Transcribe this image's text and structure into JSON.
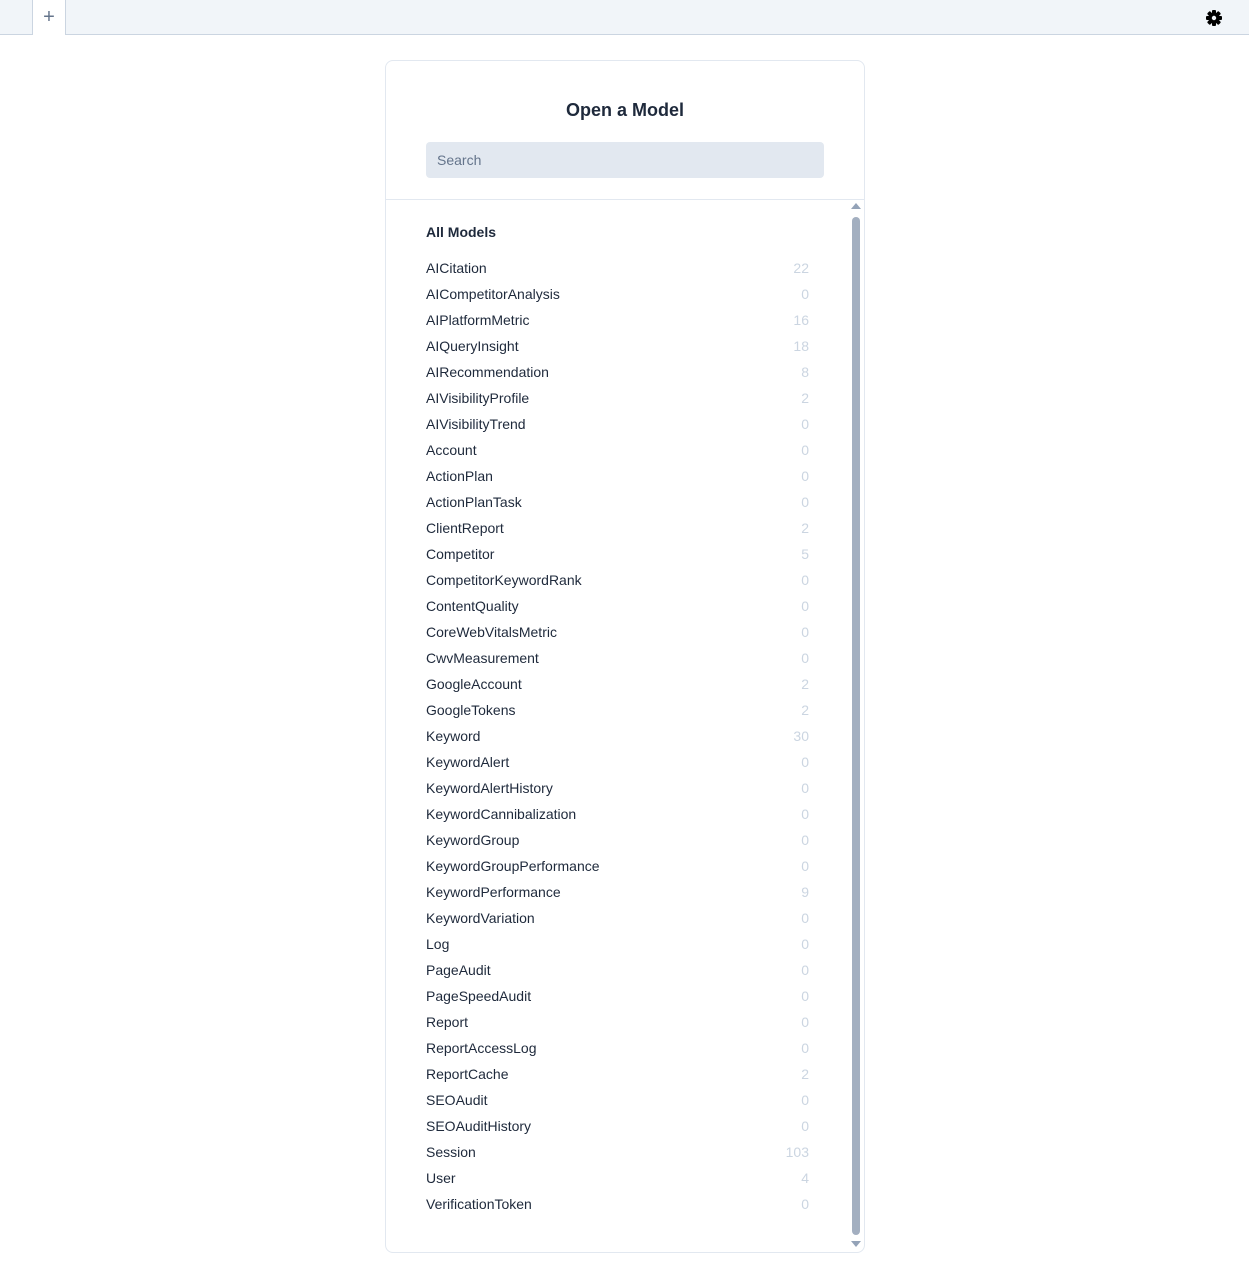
{
  "topbar": {
    "add_tab_label": "+",
    "settings_icon": "gear-icon"
  },
  "panel": {
    "title": "Open a Model",
    "search_placeholder": "Search",
    "search_value": "",
    "section_heading": "All Models",
    "models": [
      {
        "name": "AICitation",
        "count": "22"
      },
      {
        "name": "AICompetitorAnalysis",
        "count": "0"
      },
      {
        "name": "AIPlatformMetric",
        "count": "16"
      },
      {
        "name": "AIQueryInsight",
        "count": "18"
      },
      {
        "name": "AIRecommendation",
        "count": "8"
      },
      {
        "name": "AIVisibilityProfile",
        "count": "2"
      },
      {
        "name": "AIVisibilityTrend",
        "count": "0"
      },
      {
        "name": "Account",
        "count": "0"
      },
      {
        "name": "ActionPlan",
        "count": "0"
      },
      {
        "name": "ActionPlanTask",
        "count": "0"
      },
      {
        "name": "ClientReport",
        "count": "2"
      },
      {
        "name": "Competitor",
        "count": "5"
      },
      {
        "name": "CompetitorKeywordRank",
        "count": "0"
      },
      {
        "name": "ContentQuality",
        "count": "0"
      },
      {
        "name": "CoreWebVitalsMetric",
        "count": "0"
      },
      {
        "name": "CwvMeasurement",
        "count": "0"
      },
      {
        "name": "GoogleAccount",
        "count": "2"
      },
      {
        "name": "GoogleTokens",
        "count": "2"
      },
      {
        "name": "Keyword",
        "count": "30"
      },
      {
        "name": "KeywordAlert",
        "count": "0"
      },
      {
        "name": "KeywordAlertHistory",
        "count": "0"
      },
      {
        "name": "KeywordCannibalization",
        "count": "0"
      },
      {
        "name": "KeywordGroup",
        "count": "0"
      },
      {
        "name": "KeywordGroupPerformance",
        "count": "0"
      },
      {
        "name": "KeywordPerformance",
        "count": "9"
      },
      {
        "name": "KeywordVariation",
        "count": "0"
      },
      {
        "name": "Log",
        "count": "0"
      },
      {
        "name": "PageAudit",
        "count": "0"
      },
      {
        "name": "PageSpeedAudit",
        "count": "0"
      },
      {
        "name": "Report",
        "count": "0"
      },
      {
        "name": "ReportAccessLog",
        "count": "0"
      },
      {
        "name": "ReportCache",
        "count": "2"
      },
      {
        "name": "SEOAudit",
        "count": "0"
      },
      {
        "name": "SEOAuditHistory",
        "count": "0"
      },
      {
        "name": "Session",
        "count": "103"
      },
      {
        "name": "User",
        "count": "4"
      },
      {
        "name": "VerificationToken",
        "count": "0"
      }
    ]
  }
}
